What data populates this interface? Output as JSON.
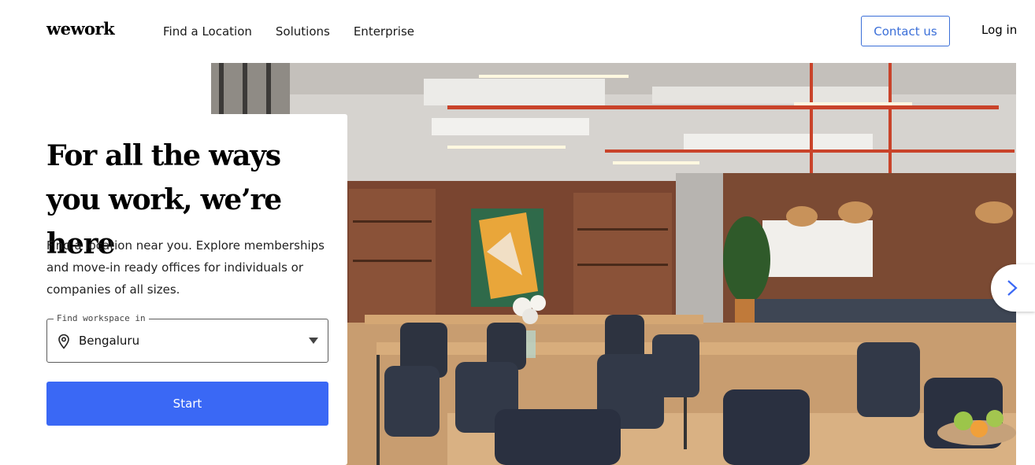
{
  "header": {
    "logo": "wework",
    "nav": [
      "Find a Location",
      "Solutions",
      "Enterprise"
    ],
    "contact_label": "Contact us",
    "login_label": "Log in"
  },
  "hero": {
    "headline": "For all the ways you work, we’re here",
    "description": "Find a location near you. Explore memberships and move-in ready offices for individuals or companies of all sizes.",
    "search": {
      "label": "Find workspace in",
      "value": "Bengaluru",
      "icon": "map-pin-icon"
    },
    "start_label": "Start",
    "next_icon": "chevron-right-icon"
  },
  "colors": {
    "accent": "#3a68f5",
    "contact_border": "#3b6fd8"
  }
}
